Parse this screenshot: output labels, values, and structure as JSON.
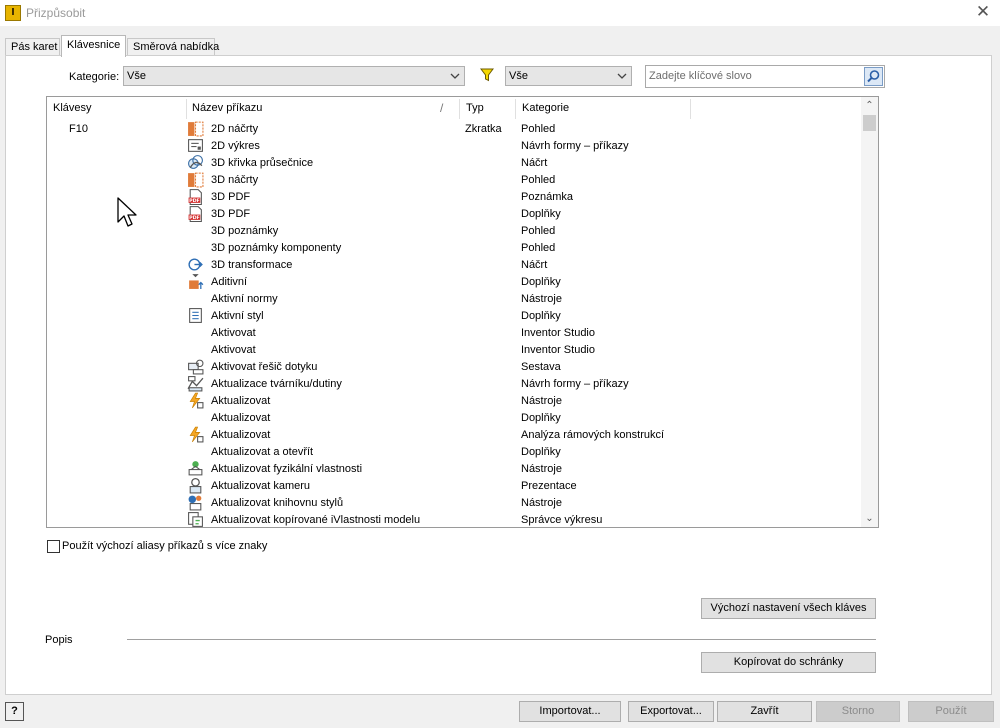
{
  "window": {
    "title": "Přizpůsobit"
  },
  "tabs": [
    {
      "label": "Pás karet"
    },
    {
      "label": "Klávesnice"
    },
    {
      "label": "Směrová nabídka"
    }
  ],
  "filters": {
    "category_label": "Kategorie:",
    "category_value": "Vše",
    "type_filter_value": "Vše",
    "search_placeholder": "Zadejte klíčové slovo"
  },
  "table": {
    "columns": [
      "Klávesy",
      "Název příkazu",
      "Typ",
      "Kategorie"
    ],
    "rows": [
      {
        "key": "F10",
        "name": "2D náčrty",
        "type": "Zkratka",
        "category": "Pohled",
        "icon": "sketch-icon"
      },
      {
        "key": "",
        "name": "2D výkres",
        "type": "",
        "category": "Návrh formy – příkazy",
        "icon": "drawing-icon"
      },
      {
        "key": "",
        "name": "3D křivka průsečnice",
        "type": "",
        "category": "Náčrt",
        "icon": "intersection-curve-icon"
      },
      {
        "key": "",
        "name": "3D náčrty",
        "type": "",
        "category": "Pohled",
        "icon": "sketch-icon"
      },
      {
        "key": "",
        "name": "3D PDF",
        "type": "",
        "category": "Poznámka",
        "icon": "pdf-icon"
      },
      {
        "key": "",
        "name": "3D PDF",
        "type": "",
        "category": "Doplňky",
        "icon": "pdf-icon"
      },
      {
        "key": "",
        "name": "3D poznámky",
        "type": "",
        "category": "Pohled",
        "icon": ""
      },
      {
        "key": "",
        "name": "3D poznámky komponenty",
        "type": "",
        "category": "Pohled",
        "icon": ""
      },
      {
        "key": "",
        "name": "3D transformace",
        "type": "",
        "category": "Náčrt",
        "icon": "transform-icon"
      },
      {
        "key": "",
        "name": "Aditivní",
        "type": "",
        "category": "Doplňky",
        "icon": "additive-icon"
      },
      {
        "key": "",
        "name": "Aktivní normy",
        "type": "",
        "category": "Nástroje",
        "icon": ""
      },
      {
        "key": "",
        "name": "Aktivní styl",
        "type": "",
        "category": "Doplňky",
        "icon": "style-icon"
      },
      {
        "key": "",
        "name": "Aktivovat",
        "type": "",
        "category": "Inventor Studio",
        "icon": ""
      },
      {
        "key": "",
        "name": "Aktivovat",
        "type": "",
        "category": "Inventor Studio",
        "icon": ""
      },
      {
        "key": "",
        "name": "Aktivovat řešič dotyku",
        "type": "",
        "category": "Sestava",
        "icon": "contact-solver-icon"
      },
      {
        "key": "",
        "name": "Aktualizace tvárníku/dutiny",
        "type": "",
        "category": "Návrh formy – příkazy",
        "icon": "core-cavity-icon"
      },
      {
        "key": "",
        "name": "Aktualizovat",
        "type": "",
        "category": "Nástroje",
        "icon": "update-icon"
      },
      {
        "key": "",
        "name": "Aktualizovat",
        "type": "",
        "category": "Doplňky",
        "icon": ""
      },
      {
        "key": "",
        "name": "Aktualizovat",
        "type": "",
        "category": "Analýza rámových konstrukcí",
        "icon": "update-icon"
      },
      {
        "key": "",
        "name": "Aktualizovat a otevřít",
        "type": "",
        "category": "Doplňky",
        "icon": ""
      },
      {
        "key": "",
        "name": "Aktualizovat fyzikální vlastnosti",
        "type": "",
        "category": "Nástroje",
        "icon": "physical-properties-icon"
      },
      {
        "key": "",
        "name": "Aktualizovat kameru",
        "type": "",
        "category": "Prezentace",
        "icon": "camera-icon"
      },
      {
        "key": "",
        "name": "Aktualizovat knihovnu stylů",
        "type": "",
        "category": "Nástroje",
        "icon": "style-library-icon"
      },
      {
        "key": "",
        "name": "Aktualizovat kopírované iVlastnosti modelu",
        "type": "",
        "category": "Správce výkresu",
        "icon": "copy-iproperties-icon"
      }
    ]
  },
  "options": {
    "aliases_label": "Použít výchozí aliasy příkazů s více znaky"
  },
  "buttons": {
    "reset_all": "Výchozí nastavení všech kláves",
    "copy_clipboard": "Kopírovat do schránky",
    "import": "Importovat...",
    "export": "Exportovat...",
    "close": "Zavřít",
    "cancel": "Storno",
    "apply": "Použít",
    "help": "?"
  },
  "description_label": "Popis"
}
